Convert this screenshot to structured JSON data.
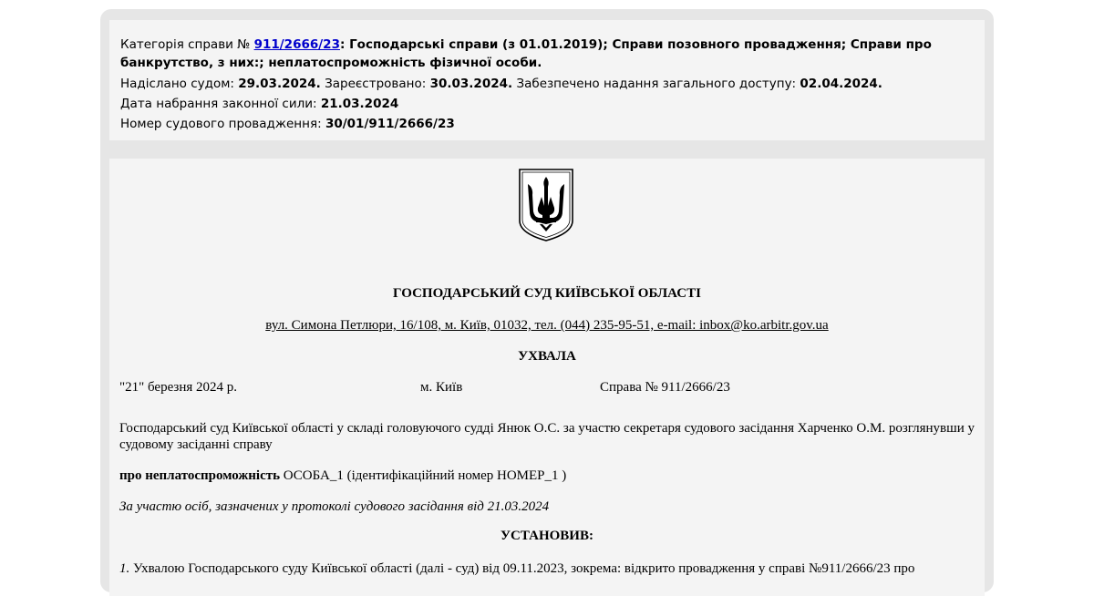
{
  "info": {
    "category_label": "Категорія справи №",
    "case_number_link": "911/2666/23",
    "category_text": ": Господарські справи (з 01.01.2019); Справи позовного провадження; Справи про банкрутство, з них:; неплатоспроможність фізичної особи.",
    "sent_label": "Надіслано судом:",
    "sent_value": "29.03.2024.",
    "registered_label": "Зареєстровано:",
    "registered_value": "30.03.2024.",
    "access_label": "Забезпечено надання загального доступу:",
    "access_value": "02.04.2024.",
    "legal_force_label": "Дата набрання законної сили:",
    "legal_force_value": "21.03.2024",
    "proceeding_label": "Номер судового провадження:",
    "proceeding_value": "30/01/911/2666/23"
  },
  "document": {
    "court_name": "ГОСПОДАРСЬКИЙ СУД КИЇВСЬКОЇ ОБЛАСТІ",
    "court_address": "вул. Симона Петлюри, 16/108, м. Київ, 01032, тел. (044) 235-95-51, e-mail: inbox@ko.arbitr.gov.ua",
    "doc_type": "УХВАЛА",
    "date": "\"21\" березня 2024 р.",
    "city": "м. Київ",
    "case": "Справа № 911/2666/23",
    "para1": "Господарський суд Київської області у складі головуючого судді Янюк О.С. за участю секретаря судового засідання Харченко О.М. розглянувши у судовому засіданні справу",
    "para2_bold": "про неплатоспроможність",
    "para2_rest": " ОСОБА_1 (ідентифікаційний номер НОМЕР_1 )",
    "para3": "За участю осіб, зазначених у протоколі судового засідання від 21.03.2024",
    "ustanovyv": "УСТАНОВИВ:",
    "para4_num": "1.",
    "para4_text": " Ухвалою Господарського суду Київської області (далі - суд) від 09.11.2023, зокрема: відкрито провадження у справі №911/2666/23 про"
  },
  "icons": {
    "emblem": "coat-of-arms-icon"
  }
}
